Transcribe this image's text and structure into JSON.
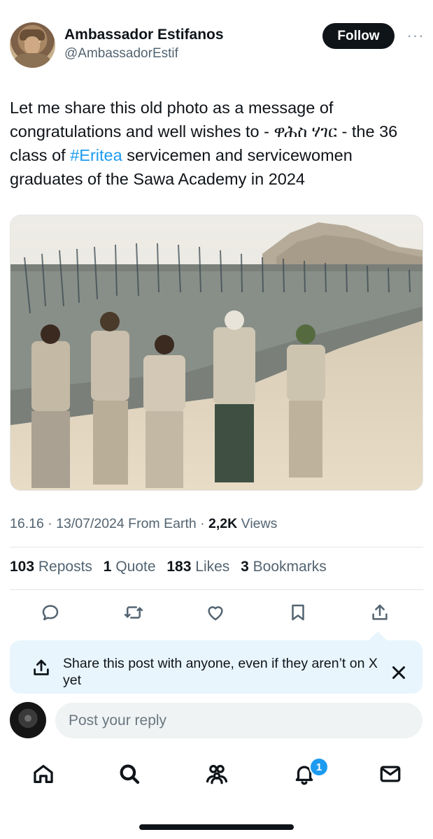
{
  "author": {
    "name": "Ambassador Estifanos",
    "handle": "@AmbassadorEstif",
    "follow_label": "Follow",
    "more_label": "···"
  },
  "post": {
    "text_before": "Let me share this old photo as a message of congratulations and well wishes to - ዋሕስ ሃገር - the 36 class of ",
    "hashtag": "#Eritea",
    "text_after": " servicemen and servicewomen graduates of the Sawa Academy in 2024",
    "image_icon": "photo-soldiers-icon"
  },
  "meta": {
    "time": "16.16",
    "sep1": " · ",
    "date": "13/07/2024",
    "source": " From Earth",
    "sep2": " · ",
    "views_count": "2,2K",
    "views_label": " Views"
  },
  "stats": {
    "reposts_count": "103",
    "reposts_label": "Reposts",
    "quotes_count": "1",
    "quotes_label": "Quote",
    "likes_count": "183",
    "likes_label": "Likes",
    "bookmarks_count": "3",
    "bookmarks_label": "Bookmarks"
  },
  "actions": [
    "reply-icon",
    "repost-icon",
    "like-icon",
    "bookmark-icon",
    "share-icon"
  ],
  "banner": {
    "text": "Share this post with anyone, even if they aren’t on X yet",
    "icon": "share-icon",
    "close_icon": "close-icon"
  },
  "reply": {
    "placeholder": "Post your reply"
  },
  "nav": {
    "items": [
      "home-icon",
      "search-icon",
      "communities-icon",
      "notifications-icon",
      "messages-icon"
    ],
    "notifications_badge": "1"
  },
  "colors": {
    "accent": "#1d9bf0",
    "text": "#0f1419",
    "secondary": "#536471",
    "follow_bg": "#0f1419",
    "banner_bg": "#e8f5fd"
  }
}
